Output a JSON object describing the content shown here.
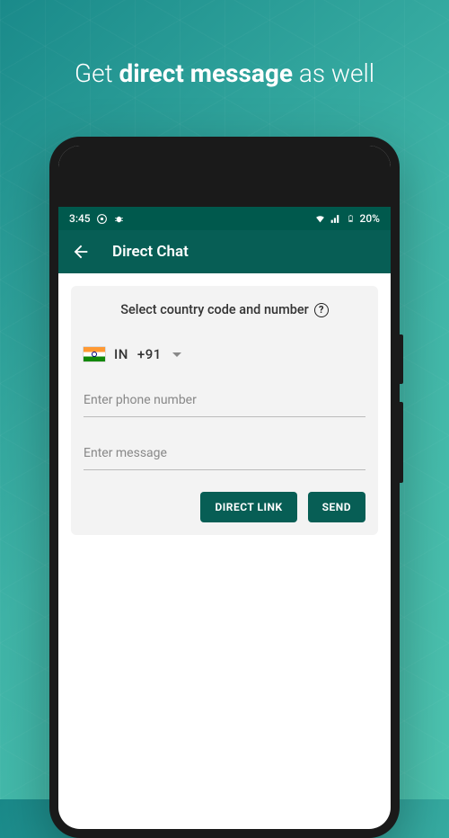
{
  "headline": {
    "prefix": "Get ",
    "bold": "direct message",
    "suffix": " as well"
  },
  "status": {
    "time": "3:45",
    "battery": "20%"
  },
  "appbar": {
    "title": "Direct Chat"
  },
  "card": {
    "title": "Select country code and number",
    "help_glyph": "?",
    "country_code": "IN",
    "dial_code": "+91",
    "phone_placeholder": "Enter phone number",
    "message_placeholder": "Enter message",
    "direct_link_label": "DIRECT LINK",
    "send_label": "SEND"
  },
  "colors": {
    "accent": "#075e55",
    "status_bg": "#00594d"
  }
}
